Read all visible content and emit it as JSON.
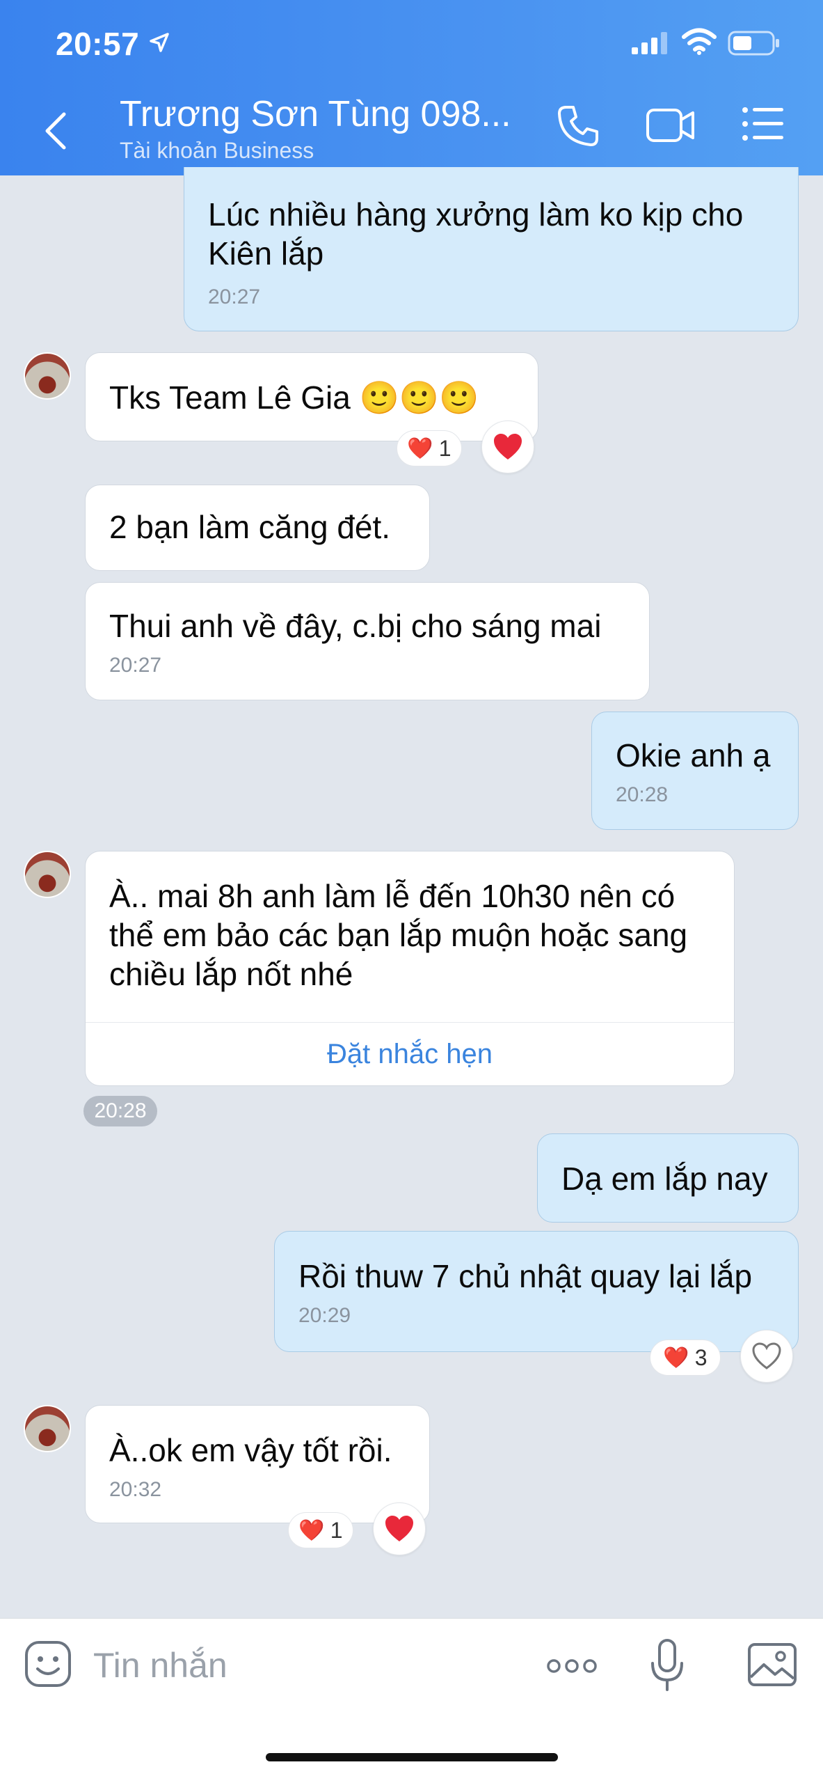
{
  "status_bar": {
    "time": "20:57"
  },
  "header": {
    "title": "Trương Sơn Tùng 098...",
    "subtitle": "Tài khoản Business"
  },
  "messages": [
    {
      "id": "m1",
      "side": "out",
      "text": "Lúc nhiều hàng xưởng làm ko kịp cho Kiên lắp",
      "time": "20:27"
    },
    {
      "id": "m2",
      "side": "in",
      "text": "Tks Team Lê Gia 🙂🙂🙂",
      "reaction": {
        "emoji": "❤️",
        "count": "1"
      }
    },
    {
      "id": "m3",
      "side": "in",
      "text": "2 bạn làm căng đét."
    },
    {
      "id": "m4",
      "side": "in",
      "text": "Thui anh về đây, c.bị cho sáng mai",
      "time": "20:27"
    },
    {
      "id": "m5",
      "side": "out",
      "text": "Okie anh ạ",
      "time": "20:28"
    },
    {
      "id": "m6",
      "side": "in",
      "text": "À.. mai 8h anh làm lễ đến 10h30 nên có thể em bảo các bạn lắp muộn hoặc sang chiều lắp nốt nhé",
      "action": "Đặt nhắc hẹn",
      "time": "20:28"
    },
    {
      "id": "m7",
      "side": "out",
      "text": "Dạ em lắp nay"
    },
    {
      "id": "m8",
      "side": "out",
      "text": "Rồi thuw 7 chủ nhật quay lại lắp",
      "time": "20:29",
      "reaction": {
        "emoji": "❤️",
        "count": "3"
      }
    },
    {
      "id": "m9",
      "side": "in",
      "text": "À..ok em vậy tốt rồi.",
      "time": "20:32",
      "reaction": {
        "emoji": "❤️",
        "count": "1"
      }
    }
  ],
  "input": {
    "placeholder": "Tin nhắn"
  },
  "colors": {
    "header": "#3a83ee",
    "outgoing": "#d5ebfb",
    "incoming": "#ffffff",
    "background": "#e1e6ed",
    "link": "#3a84de",
    "heart": "#e8283a"
  }
}
